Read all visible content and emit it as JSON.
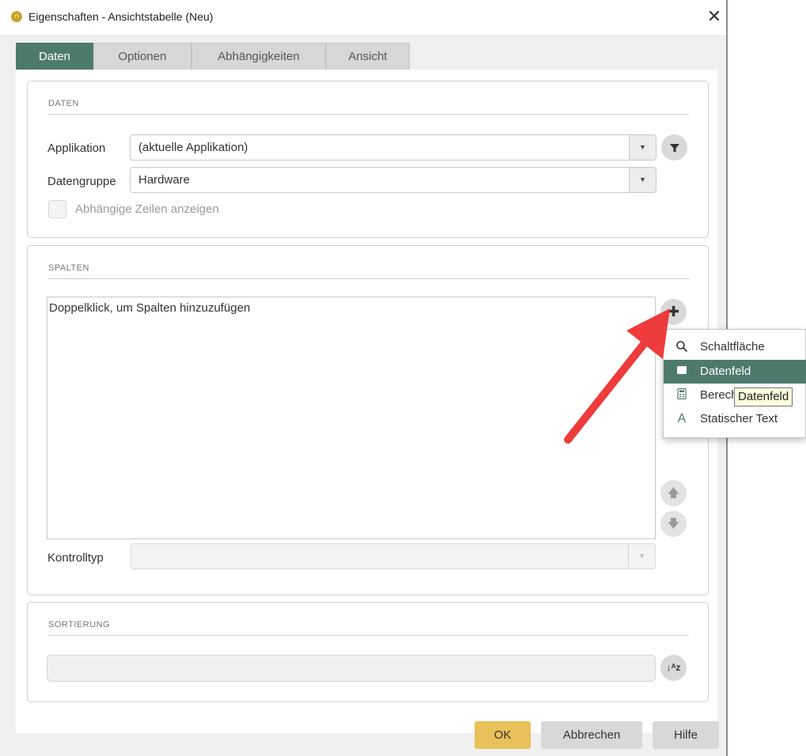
{
  "window": {
    "title": "Eigenschaften - Ansichtstabelle (Neu)",
    "close_glyph": "✕",
    "app_icon_glyph": "∩"
  },
  "tabs": [
    {
      "label": "Daten",
      "active": true
    },
    {
      "label": "Optionen",
      "active": false
    },
    {
      "label": "Abhängigkeiten",
      "active": false
    },
    {
      "label": "Ansicht",
      "active": false
    }
  ],
  "daten": {
    "title": "DATEN",
    "applikation_label": "Applikation",
    "applikation_value": "(aktuelle Applikation)",
    "datengruppe_label": "Datengruppe",
    "datengruppe_value": "Hardware",
    "abhaengige_label": "Abhängige Zeilen anzeigen",
    "abhaengige_checked": false
  },
  "spalten": {
    "title": "SPALTEN",
    "hint": "Doppelklick, um Spalten hinzuzufügen",
    "kontrolltyp_label": "Kontrolltyp",
    "kontrolltyp_value": ""
  },
  "sortierung": {
    "title": "SORTIERUNG",
    "value": ""
  },
  "buttons": {
    "ok": "OK",
    "abbrechen": "Abbrechen",
    "hilfe": "Hilfe"
  },
  "add_menu": {
    "items": [
      {
        "label": "Schaltfläche",
        "icon": "search-icon",
        "selected": false
      },
      {
        "label": "Datenfeld",
        "icon": "square-icon",
        "selected": true
      },
      {
        "label": "Berech",
        "icon": "calculator-icon",
        "selected": false
      },
      {
        "label": "Statischer Text",
        "icon": "letter-a-icon",
        "selected": false
      }
    ]
  },
  "tooltip": {
    "text": "Datenfeld"
  },
  "colors": {
    "accent": "#4d7a6c",
    "ok_button": "#e8c15a",
    "arrow": "#ee3b3b",
    "tooltip_bg": "#ffffe1"
  }
}
